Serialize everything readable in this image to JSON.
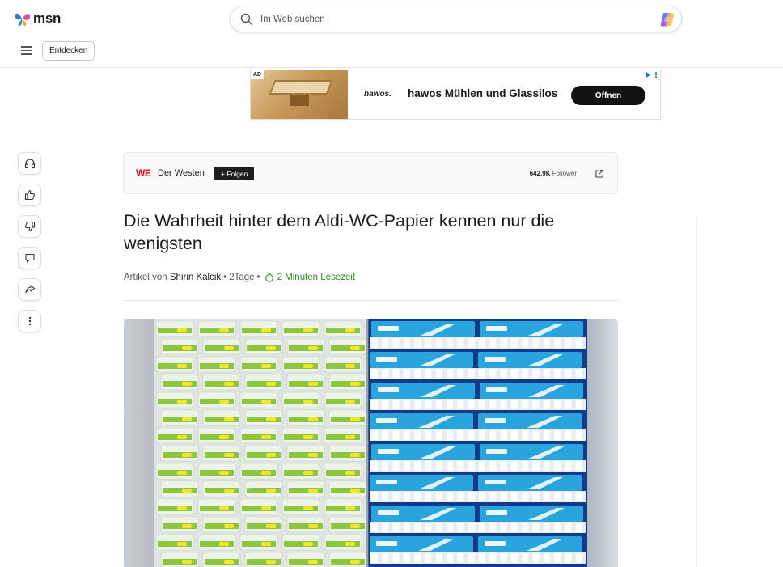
{
  "header": {
    "logo_text": "msn",
    "search_placeholder": "Im Web suchen",
    "discover_label": "Entdecken"
  },
  "ad": {
    "tag": "AD",
    "brand_logo": "hawos.",
    "headline": "hawos Mühlen und Glassilos",
    "cta_label": "Öffnen"
  },
  "rail": {
    "items": [
      "headphones-icon",
      "thumbs-up-icon",
      "thumbs-down-icon",
      "comment-icon",
      "share-icon",
      "more-icon"
    ]
  },
  "publisher": {
    "logo": "WE",
    "name": "Der Westen",
    "follow_label": "+ Folgen",
    "followers_count": "642.9K",
    "followers_label": "Follower"
  },
  "article": {
    "title": "Die Wahrheit hinter dem Aldi-WC-Papier kennen nur die wenigsten",
    "byline_prefix": "Artikel von",
    "author": "Shirin Kalcik",
    "age": "2Tage",
    "read_time": "2 Minuten Lesezeit"
  },
  "colors": {
    "accent_green": "#2d8a1a",
    "publisher_red": "#e3000f",
    "paper_green": "#8cc63f",
    "paper_blue": "#1e6fd0"
  }
}
